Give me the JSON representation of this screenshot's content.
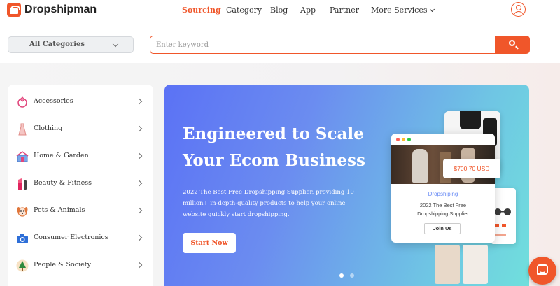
{
  "brand": {
    "name": "Dropshipman"
  },
  "nav": [
    {
      "label": "Sourcing",
      "active": true
    },
    {
      "label": "Category"
    },
    {
      "label": "Blog"
    },
    {
      "label": "App"
    },
    {
      "label": "Partner"
    },
    {
      "label": "More Services",
      "has_dropdown": true
    }
  ],
  "search": {
    "category_label": "All Categories",
    "placeholder": "Enter keyword",
    "value": ""
  },
  "sidebar": {
    "items": [
      {
        "label": "Accessories",
        "icon": "gem-ring-icon"
      },
      {
        "label": "Clothing",
        "icon": "dress-icon"
      },
      {
        "label": "Home & Garden",
        "icon": "home-garden-icon"
      },
      {
        "label": "Beauty & Fitness",
        "icon": "lipstick-icon"
      },
      {
        "label": "Pets & Animals",
        "icon": "dog-icon"
      },
      {
        "label": "Consumer Electronics",
        "icon": "camera-icon"
      },
      {
        "label": "People & Society",
        "icon": "christmas-tree-icon"
      }
    ]
  },
  "banner": {
    "title_line1": "Engineered to Scale",
    "title_line2": "Your Ecom Business",
    "description": "2022 The Best Free Dropshipping Supplier, providing 10 million+ in-depth-quality products to help your online website quickly start dropshipping.",
    "cta": "Start Now",
    "slide_count": 2,
    "active_slide": 1
  },
  "mockup": {
    "price": "$700,70 USD",
    "brand": "Dropshiping",
    "sub_line1": "2022 The Best Free",
    "sub_line2": "Dropshipping Supplier",
    "join": "Join Us"
  },
  "colors": {
    "accent": "#f0562a",
    "banner_start": "#5b72f5",
    "banner_end": "#70e0dc"
  }
}
